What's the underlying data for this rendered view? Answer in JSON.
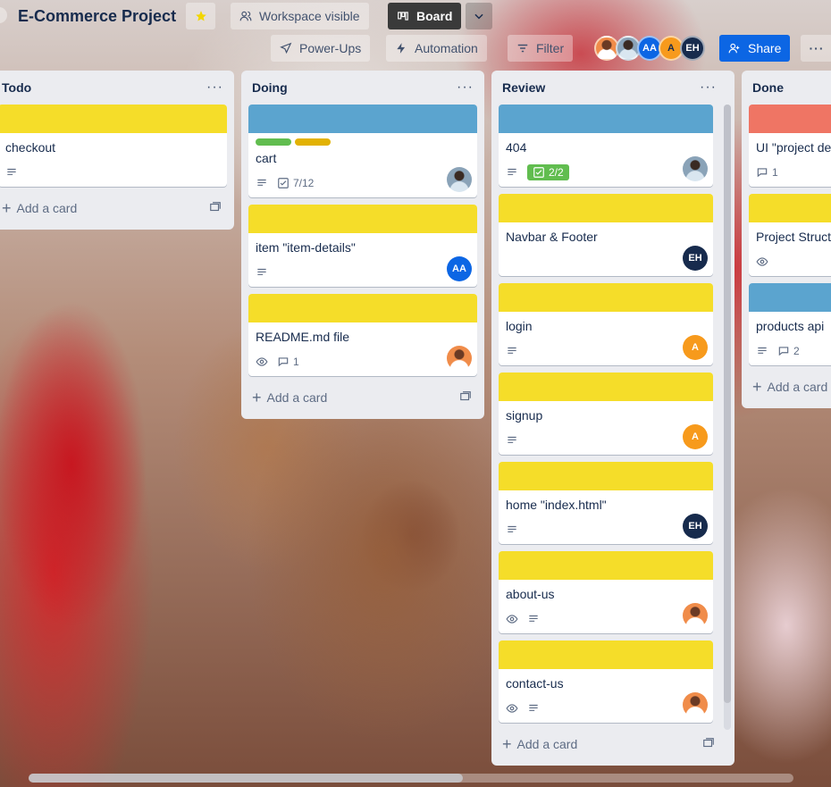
{
  "header": {
    "title": "E-Commerce Project",
    "workspace_label": "Workspace visible",
    "board_label": "Board",
    "powerups_label": "Power-Ups",
    "automation_label": "Automation",
    "filter_label": "Filter",
    "share_label": "Share",
    "members": [
      "photo",
      "photo",
      "AA",
      "A",
      "EH"
    ],
    "colors": {
      "share": "#0c66e4",
      "board_btn": "#3a3a3a",
      "star": "#f2d600"
    }
  },
  "lists": [
    {
      "title": "Todo",
      "add_label": "Add a card",
      "cards": [
        {
          "cover": "#f5dd29",
          "title": "checkout",
          "badges": [
            "description"
          ]
        }
      ]
    },
    {
      "title": "Doing",
      "add_label": "Add a card",
      "cards": [
        {
          "cover": "#5ba4cf",
          "labels": [
            "#61bd4f",
            "#e2b203"
          ],
          "title": "cart",
          "checklist": "7/12",
          "member": "photo2"
        },
        {
          "cover": "#f5dd29",
          "title": "item \"item-details\"",
          "member": "AA"
        },
        {
          "cover": "#f5dd29",
          "title": "README.md file",
          "comments": "1",
          "member": "photo1"
        }
      ]
    },
    {
      "title": "Review",
      "add_label": "Add a card",
      "cards": [
        {
          "cover": "#5ba4cf",
          "title": "404",
          "checklist": "2/2",
          "member": "photo2"
        },
        {
          "cover": "#f5dd29",
          "title": "Navbar & Footer",
          "member": "EH"
        },
        {
          "cover": "#f5dd29",
          "title": "login",
          "member": "A"
        },
        {
          "cover": "#f5dd29",
          "title": "signup",
          "member": "A"
        },
        {
          "cover": "#f5dd29",
          "title": "home \"index.html\"",
          "member": "EH"
        },
        {
          "cover": "#f5dd29",
          "title": "about-us",
          "member": "photo1"
        },
        {
          "cover": "#f5dd29",
          "title": "contact-us",
          "member": "photo1"
        }
      ]
    },
    {
      "title": "Done",
      "add_label": "Add a card",
      "cards": [
        {
          "cover": "#ef7564",
          "title": "UI \"project de",
          "comments": "1"
        },
        {
          "cover": "#f5dd29",
          "title": "Project Structu"
        },
        {
          "cover": "#5ba4cf",
          "title": "products api",
          "comments": "2"
        }
      ]
    }
  ],
  "avatars": {
    "AA": "AA",
    "A": "A",
    "EH": "EH"
  },
  "icons": {
    "star": "star-icon",
    "workspace": "people-icon",
    "board": "board-icon",
    "powerups": "rocket-icon",
    "automation": "lightning-icon",
    "filter": "filter-icon",
    "share": "add-person-icon",
    "description": "description-icon",
    "checklist": "checklist-icon",
    "comment": "comment-icon",
    "watch": "eye-icon"
  }
}
